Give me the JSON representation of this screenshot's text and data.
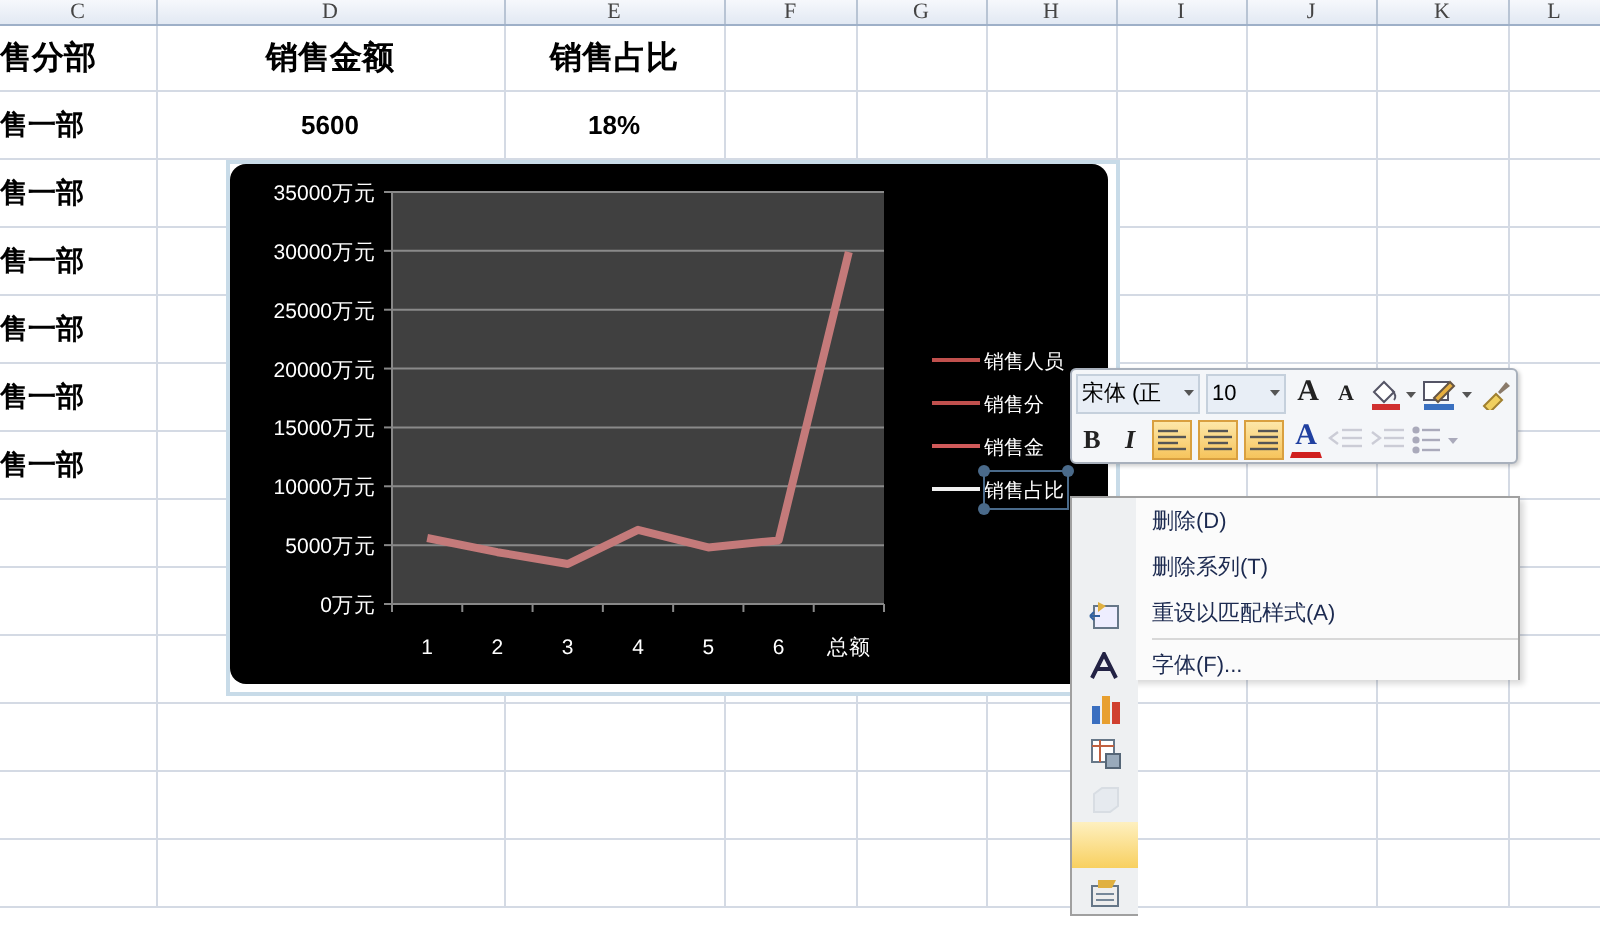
{
  "sheet": {
    "columns": [
      "C",
      "D",
      "E",
      "F",
      "G",
      "H",
      "I",
      "J",
      "K",
      "L"
    ],
    "rows": [
      {
        "kind": "header",
        "cells": [
          "售分部",
          "销售金额",
          "销售占比"
        ]
      },
      {
        "kind": "data",
        "cells": [
          "售一部",
          "5600",
          "18%"
        ]
      },
      {
        "kind": "data",
        "cells": [
          "售一部"
        ]
      },
      {
        "kind": "data",
        "cells": [
          "售一部"
        ]
      },
      {
        "kind": "data",
        "cells": [
          "售一部"
        ]
      },
      {
        "kind": "data",
        "cells": [
          "售一部"
        ]
      },
      {
        "kind": "data",
        "cells": [
          "售一部"
        ]
      }
    ]
  },
  "chart": {
    "chart_data": {
      "type": "line",
      "categories": [
        "1",
        "2",
        "3",
        "4",
        "5",
        "6",
        "总额"
      ],
      "series": [
        {
          "color": "#c47a7a",
          "values": [
            5600,
            4400,
            3400,
            6300,
            4800,
            5400,
            29900
          ]
        }
      ],
      "ylim": [
        0,
        35000
      ],
      "grid": true,
      "yticks": [
        {
          "value": 0,
          "label": "0万元"
        },
        {
          "value": 5000,
          "label": "5000万元"
        },
        {
          "value": 10000,
          "label": "10000万元"
        },
        {
          "value": 15000,
          "label": "15000万元"
        },
        {
          "value": 20000,
          "label": "20000万元"
        },
        {
          "value": 25000,
          "label": "25000万元"
        },
        {
          "value": 30000,
          "label": "30000万元"
        },
        {
          "value": 35000,
          "label": "35000万元"
        }
      ]
    },
    "legend": [
      {
        "label": "销售人员",
        "color": "#c0504d",
        "selected": false
      },
      {
        "label": "销售分",
        "color": "#c0504d",
        "selected": false
      },
      {
        "label": "销售金",
        "color": "#d05a5a",
        "selected": false
      },
      {
        "label": "销售占比",
        "color": "#f0f0f0",
        "selected": true
      }
    ]
  },
  "mini_toolbar": {
    "font_name": "宋体 (正",
    "font_size": "10",
    "row1": [
      {
        "kind": "grow",
        "glyph": "A"
      },
      {
        "kind": "shrink",
        "glyph": "A"
      },
      {
        "kind": "fill"
      },
      {
        "kind": "outline"
      },
      {
        "kind": "painter"
      }
    ],
    "row2": [
      {
        "kind": "bold",
        "glyph": "B",
        "selected": false,
        "disabled": false
      },
      {
        "kind": "italic",
        "glyph": "I",
        "selected": false,
        "disabled": false
      },
      {
        "kind": "align-left",
        "selected": true,
        "disabled": false
      },
      {
        "kind": "align-center",
        "selected": true,
        "disabled": false
      },
      {
        "kind": "align-right",
        "selected": true,
        "disabled": false
      },
      {
        "kind": "font-color",
        "glyph": "A",
        "selected": false,
        "disabled": false
      },
      {
        "kind": "outdent",
        "selected": false,
        "disabled": true
      },
      {
        "kind": "indent",
        "selected": false,
        "disabled": true
      },
      {
        "kind": "bullets",
        "selected": false,
        "disabled": true
      }
    ]
  },
  "context_menu": {
    "items": [
      {
        "kind": "plain",
        "label": "删除(D)",
        "selected": false
      },
      {
        "kind": "plain",
        "label": "删除系列(T)",
        "selected": false
      },
      {
        "kind": "reset",
        "label": "重设以匹配样式(A)",
        "selected": false
      },
      {
        "kind": "font",
        "label": "字体(F)...",
        "selected": false
      }
    ],
    "strip_rows": [
      {
        "kind": "chart",
        "selected": false,
        "disabled": false
      },
      {
        "kind": "table",
        "selected": false,
        "disabled": false
      },
      {
        "kind": "cube",
        "selected": false,
        "disabled": true
      },
      {
        "kind": "blank",
        "selected": true,
        "disabled": false
      },
      {
        "kind": "format",
        "selected": false,
        "disabled": false
      }
    ]
  }
}
